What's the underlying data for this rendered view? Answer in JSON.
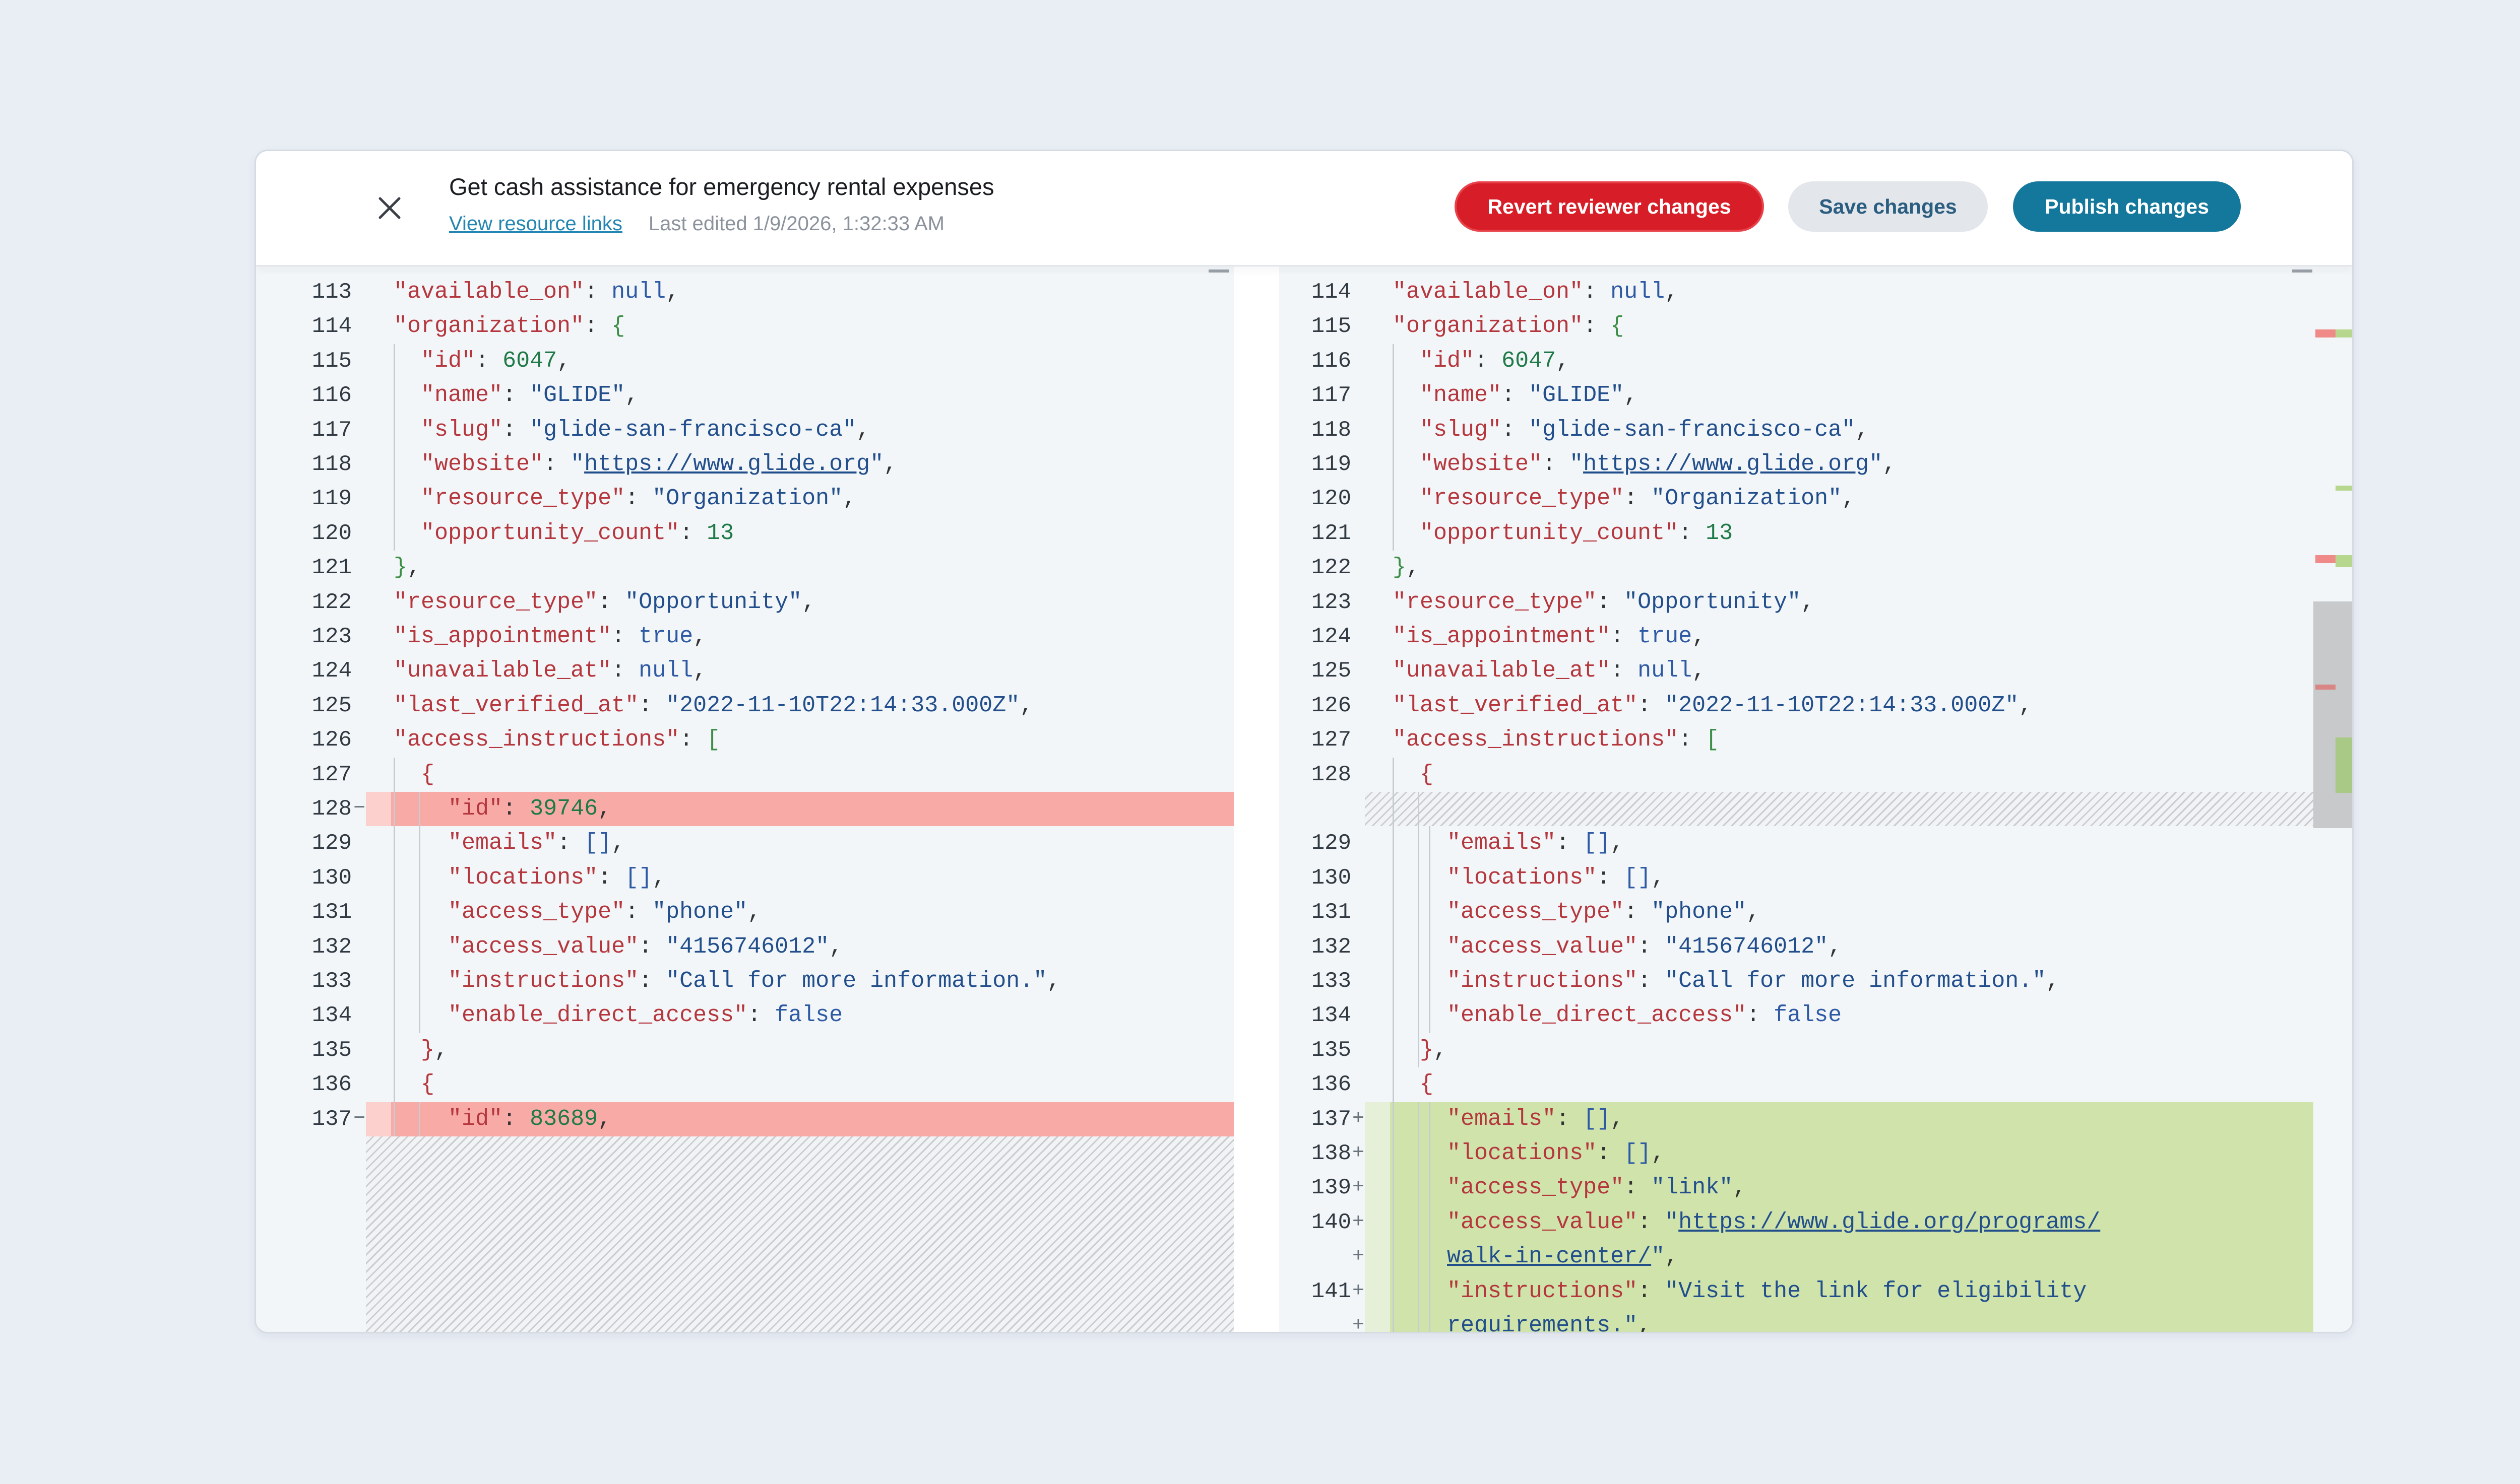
{
  "header": {
    "title": "Get cash assistance for emergency rental expenses",
    "view_links": "View resource links",
    "last_edited": "Last edited 1/9/2026, 1:32:33 AM",
    "revert_label": "Revert reviewer changes",
    "save_label": "Save changes",
    "publish_label": "Publish changes"
  },
  "left_lines": [
    {
      "n": "113",
      "c": [
        [
          "k",
          "\"available_on\""
        ],
        [
          "p",
          ": "
        ],
        [
          "b",
          "null"
        ],
        [
          "p",
          ","
        ]
      ]
    },
    {
      "n": "114",
      "c": [
        [
          "k",
          "\"organization\""
        ],
        [
          "p",
          ": "
        ],
        [
          "g",
          "{"
        ]
      ]
    },
    {
      "n": "115",
      "c": [
        [
          "p",
          "  "
        ],
        [
          "k",
          "\"id\""
        ],
        [
          "p",
          ": "
        ],
        [
          "n",
          "6047"
        ],
        [
          "p",
          ","
        ]
      ]
    },
    {
      "n": "116",
      "c": [
        [
          "p",
          "  "
        ],
        [
          "k",
          "\"name\""
        ],
        [
          "p",
          ": "
        ],
        [
          "s",
          "\"GLIDE\""
        ],
        [
          "p",
          ","
        ]
      ]
    },
    {
      "n": "117",
      "c": [
        [
          "p",
          "  "
        ],
        [
          "k",
          "\"slug\""
        ],
        [
          "p",
          ": "
        ],
        [
          "s",
          "\"glide-san-francisco-ca\""
        ],
        [
          "p",
          ","
        ]
      ]
    },
    {
      "n": "118",
      "c": [
        [
          "p",
          "  "
        ],
        [
          "k",
          "\"website\""
        ],
        [
          "p",
          ": "
        ],
        [
          "s",
          "\""
        ],
        [
          "u",
          "https://www.glide.org"
        ],
        [
          "s",
          "\""
        ],
        [
          "p",
          ","
        ]
      ]
    },
    {
      "n": "119",
      "c": [
        [
          "p",
          "  "
        ],
        [
          "k",
          "\"resource_type\""
        ],
        [
          "p",
          ": "
        ],
        [
          "s",
          "\"Organization\""
        ],
        [
          "p",
          ","
        ]
      ]
    },
    {
      "n": "120",
      "c": [
        [
          "p",
          "  "
        ],
        [
          "k",
          "\"opportunity_count\""
        ],
        [
          "p",
          ": "
        ],
        [
          "n",
          "13"
        ]
      ]
    },
    {
      "n": "121",
      "c": [
        [
          "g",
          "}"
        ],
        [
          "p",
          ","
        ]
      ]
    },
    {
      "n": "122",
      "c": [
        [
          "k",
          "\"resource_type\""
        ],
        [
          "p",
          ": "
        ],
        [
          "s",
          "\"Opportunity\""
        ],
        [
          "p",
          ","
        ]
      ]
    },
    {
      "n": "123",
      "c": [
        [
          "k",
          "\"is_appointment\""
        ],
        [
          "p",
          ": "
        ],
        [
          "b",
          "true"
        ],
        [
          "p",
          ","
        ]
      ]
    },
    {
      "n": "124",
      "c": [
        [
          "k",
          "\"unavailable_at\""
        ],
        [
          "p",
          ": "
        ],
        [
          "b",
          "null"
        ],
        [
          "p",
          ","
        ]
      ]
    },
    {
      "n": "125",
      "c": [
        [
          "k",
          "\"last_verified_at\""
        ],
        [
          "p",
          ": "
        ],
        [
          "s",
          "\"2022-11-10T22:14:33.000Z\""
        ],
        [
          "p",
          ","
        ]
      ]
    },
    {
      "n": "126",
      "c": [
        [
          "k",
          "\"access_instructions\""
        ],
        [
          "p",
          ": "
        ],
        [
          "g",
          "["
        ]
      ]
    },
    {
      "n": "127",
      "c": [
        [
          "p",
          "  "
        ],
        [
          "k",
          "{"
        ]
      ]
    },
    {
      "n": "128",
      "m": "−",
      "del": true,
      "c": [
        [
          "p",
          "    "
        ],
        [
          "k",
          "\"id\""
        ],
        [
          "p",
          ": "
        ],
        [
          "n",
          "39746"
        ],
        [
          "p",
          ","
        ]
      ]
    },
    {
      "n": "129",
      "c": [
        [
          "p",
          "    "
        ],
        [
          "k",
          "\"emails\""
        ],
        [
          "p",
          ": "
        ],
        [
          "b",
          "[]"
        ],
        [
          "p",
          ","
        ]
      ]
    },
    {
      "n": "130",
      "c": [
        [
          "p",
          "    "
        ],
        [
          "k",
          "\"locations\""
        ],
        [
          "p",
          ": "
        ],
        [
          "b",
          "[]"
        ],
        [
          "p",
          ","
        ]
      ]
    },
    {
      "n": "131",
      "c": [
        [
          "p",
          "    "
        ],
        [
          "k",
          "\"access_type\""
        ],
        [
          "p",
          ": "
        ],
        [
          "s",
          "\"phone\""
        ],
        [
          "p",
          ","
        ]
      ]
    },
    {
      "n": "132",
      "c": [
        [
          "p",
          "    "
        ],
        [
          "k",
          "\"access_value\""
        ],
        [
          "p",
          ": "
        ],
        [
          "s",
          "\"4156746012\""
        ],
        [
          "p",
          ","
        ]
      ]
    },
    {
      "n": "133",
      "c": [
        [
          "p",
          "    "
        ],
        [
          "k",
          "\"instructions\""
        ],
        [
          "p",
          ": "
        ],
        [
          "s",
          "\"Call for more information.\""
        ],
        [
          "p",
          ","
        ]
      ]
    },
    {
      "n": "134",
      "c": [
        [
          "p",
          "    "
        ],
        [
          "k",
          "\"enable_direct_access\""
        ],
        [
          "p",
          ": "
        ],
        [
          "b",
          "false"
        ]
      ]
    },
    {
      "n": "135",
      "c": [
        [
          "p",
          "  "
        ],
        [
          "k",
          "}"
        ],
        [
          "p",
          ","
        ]
      ]
    },
    {
      "n": "136",
      "c": [
        [
          "p",
          "  "
        ],
        [
          "k",
          "{"
        ]
      ]
    },
    {
      "n": "137",
      "m": "−",
      "del": true,
      "c": [
        [
          "p",
          "    "
        ],
        [
          "k",
          "\"id\""
        ],
        [
          "p",
          ": "
        ],
        [
          "n",
          "83689"
        ],
        [
          "p",
          ","
        ]
      ]
    }
  ],
  "right_lines": [
    {
      "n": "114",
      "c": [
        [
          "k",
          "\"available_on\""
        ],
        [
          "p",
          ": "
        ],
        [
          "b",
          "null"
        ],
        [
          "p",
          ","
        ]
      ]
    },
    {
      "n": "115",
      "c": [
        [
          "k",
          "\"organization\""
        ],
        [
          "p",
          ": "
        ],
        [
          "g",
          "{"
        ]
      ]
    },
    {
      "n": "116",
      "c": [
        [
          "p",
          "  "
        ],
        [
          "k",
          "\"id\""
        ],
        [
          "p",
          ": "
        ],
        [
          "n",
          "6047"
        ],
        [
          "p",
          ","
        ]
      ]
    },
    {
      "n": "117",
      "c": [
        [
          "p",
          "  "
        ],
        [
          "k",
          "\"name\""
        ],
        [
          "p",
          ": "
        ],
        [
          "s",
          "\"GLIDE\""
        ],
        [
          "p",
          ","
        ]
      ]
    },
    {
      "n": "118",
      "c": [
        [
          "p",
          "  "
        ],
        [
          "k",
          "\"slug\""
        ],
        [
          "p",
          ": "
        ],
        [
          "s",
          "\"glide-san-francisco-ca\""
        ],
        [
          "p",
          ","
        ]
      ]
    },
    {
      "n": "119",
      "c": [
        [
          "p",
          "  "
        ],
        [
          "k",
          "\"website\""
        ],
        [
          "p",
          ": "
        ],
        [
          "s",
          "\""
        ],
        [
          "u",
          "https://www.glide.org"
        ],
        [
          "s",
          "\""
        ],
        [
          "p",
          ","
        ]
      ]
    },
    {
      "n": "120",
      "c": [
        [
          "p",
          "  "
        ],
        [
          "k",
          "\"resource_type\""
        ],
        [
          "p",
          ": "
        ],
        [
          "s",
          "\"Organization\""
        ],
        [
          "p",
          ","
        ]
      ]
    },
    {
      "n": "121",
      "c": [
        [
          "p",
          "  "
        ],
        [
          "k",
          "\"opportunity_count\""
        ],
        [
          "p",
          ": "
        ],
        [
          "n",
          "13"
        ]
      ]
    },
    {
      "n": "122",
      "c": [
        [
          "g",
          "}"
        ],
        [
          "p",
          ","
        ]
      ]
    },
    {
      "n": "123",
      "c": [
        [
          "k",
          "\"resource_type\""
        ],
        [
          "p",
          ": "
        ],
        [
          "s",
          "\"Opportunity\""
        ],
        [
          "p",
          ","
        ]
      ]
    },
    {
      "n": "124",
      "c": [
        [
          "k",
          "\"is_appointment\""
        ],
        [
          "p",
          ": "
        ],
        [
          "b",
          "true"
        ],
        [
          "p",
          ","
        ]
      ]
    },
    {
      "n": "125",
      "c": [
        [
          "k",
          "\"unavailable_at\""
        ],
        [
          "p",
          ": "
        ],
        [
          "b",
          "null"
        ],
        [
          "p",
          ","
        ]
      ]
    },
    {
      "n": "126",
      "c": [
        [
          "k",
          "\"last_verified_at\""
        ],
        [
          "p",
          ": "
        ],
        [
          "s",
          "\"2022-11-10T22:14:33.000Z\""
        ],
        [
          "p",
          ","
        ]
      ]
    },
    {
      "n": "127",
      "c": [
        [
          "k",
          "\"access_instructions\""
        ],
        [
          "p",
          ": "
        ],
        [
          "g",
          "["
        ]
      ]
    },
    {
      "n": "128",
      "c": [
        [
          "p",
          "  "
        ],
        [
          "k",
          "{"
        ]
      ]
    },
    {
      "n": "",
      "hatch": true,
      "c": []
    },
    {
      "n": "129",
      "c": [
        [
          "p",
          "    "
        ],
        [
          "k",
          "\"emails\""
        ],
        [
          "p",
          ": "
        ],
        [
          "b",
          "[]"
        ],
        [
          "p",
          ","
        ]
      ]
    },
    {
      "n": "130",
      "c": [
        [
          "p",
          "    "
        ],
        [
          "k",
          "\"locations\""
        ],
        [
          "p",
          ": "
        ],
        [
          "b",
          "[]"
        ],
        [
          "p",
          ","
        ]
      ]
    },
    {
      "n": "131",
      "c": [
        [
          "p",
          "    "
        ],
        [
          "k",
          "\"access_type\""
        ],
        [
          "p",
          ": "
        ],
        [
          "s",
          "\"phone\""
        ],
        [
          "p",
          ","
        ]
      ]
    },
    {
      "n": "132",
      "c": [
        [
          "p",
          "    "
        ],
        [
          "k",
          "\"access_value\""
        ],
        [
          "p",
          ": "
        ],
        [
          "s",
          "\"4156746012\""
        ],
        [
          "p",
          ","
        ]
      ]
    },
    {
      "n": "133",
      "c": [
        [
          "p",
          "    "
        ],
        [
          "k",
          "\"instructions\""
        ],
        [
          "p",
          ": "
        ],
        [
          "s",
          "\"Call for more information.\""
        ],
        [
          "p",
          ","
        ]
      ]
    },
    {
      "n": "134",
      "c": [
        [
          "p",
          "    "
        ],
        [
          "k",
          "\"enable_direct_access\""
        ],
        [
          "p",
          ": "
        ],
        [
          "b",
          "false"
        ]
      ]
    },
    {
      "n": "135",
      "c": [
        [
          "p",
          "  "
        ],
        [
          "k",
          "}"
        ],
        [
          "p",
          ","
        ]
      ]
    },
    {
      "n": "136",
      "c": [
        [
          "p",
          "  "
        ],
        [
          "k",
          "{"
        ]
      ]
    },
    {
      "n": "137",
      "m": "+",
      "add": true,
      "c": [
        [
          "p",
          "    "
        ],
        [
          "k",
          "\"emails\""
        ],
        [
          "p",
          ": "
        ],
        [
          "b",
          "[]"
        ],
        [
          "p",
          ","
        ]
      ]
    },
    {
      "n": "138",
      "m": "+",
      "add": true,
      "c": [
        [
          "p",
          "    "
        ],
        [
          "k",
          "\"locations\""
        ],
        [
          "p",
          ": "
        ],
        [
          "b",
          "[]"
        ],
        [
          "p",
          ","
        ]
      ]
    },
    {
      "n": "139",
      "m": "+",
      "add": true,
      "c": [
        [
          "p",
          "    "
        ],
        [
          "k",
          "\"access_type\""
        ],
        [
          "p",
          ": "
        ],
        [
          "s",
          "\"link\""
        ],
        [
          "p",
          ","
        ]
      ]
    },
    {
      "n": "140",
      "m": "+",
      "add": true,
      "c": [
        [
          "p",
          "    "
        ],
        [
          "k",
          "\"access_value\""
        ],
        [
          "p",
          ": "
        ],
        [
          "s",
          "\""
        ],
        [
          "u",
          "https://www.glide.org/programs/"
        ]
      ]
    },
    {
      "n": "",
      "m": "+",
      "add": true,
      "c": [
        [
          "p",
          "    "
        ],
        [
          "u",
          "walk-in-center/"
        ],
        [
          "s",
          "\""
        ],
        [
          "p",
          ","
        ]
      ]
    },
    {
      "n": "141",
      "m": "+",
      "add": true,
      "c": [
        [
          "p",
          "    "
        ],
        [
          "k",
          "\"instructions\""
        ],
        [
          "p",
          ": "
        ],
        [
          "s",
          "\"Visit the link for eligibility"
        ]
      ]
    },
    {
      "n": "",
      "m": "+",
      "add": true,
      "c": [
        [
          "p",
          "    "
        ],
        [
          "s",
          "requirements.\""
        ],
        [
          "p",
          ","
        ]
      ]
    }
  ]
}
